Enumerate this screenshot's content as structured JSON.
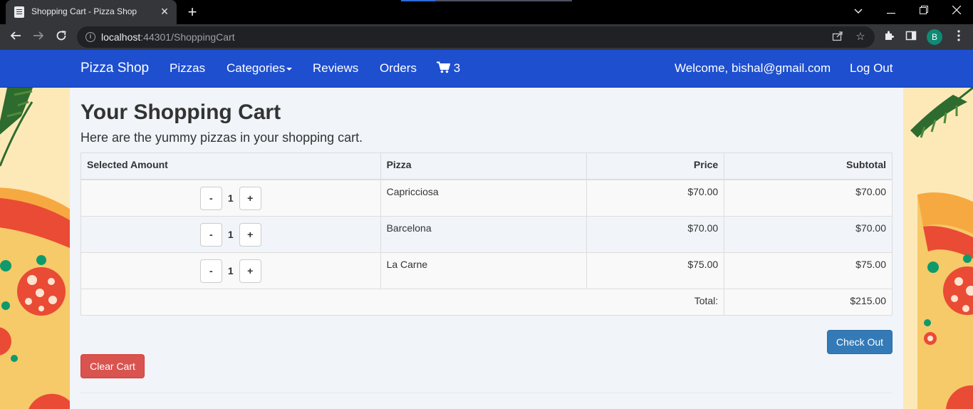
{
  "browser": {
    "tab_title": "Shopping Cart - Pizza Shop",
    "url_host": "localhost",
    "url_rest": ":44301/ShoppingCart",
    "profile_initial": "B"
  },
  "nav": {
    "brand": "Pizza Shop",
    "pizzas": "Pizzas",
    "categories": "Categories",
    "reviews": "Reviews",
    "orders": "Orders",
    "cart_count": "3",
    "welcome": "Welcome, bishal@gmail.com",
    "logout": "Log Out"
  },
  "page": {
    "title": "Your Shopping Cart",
    "subtitle": "Here are the yummy pizzas in your shopping cart."
  },
  "table": {
    "headers": [
      "Selected Amount",
      "Pizza",
      "Price",
      "Subtotal"
    ],
    "rows": [
      {
        "qty": "1",
        "pizza": "Capricciosa",
        "price": "$70.00",
        "subtotal": "$70.00"
      },
      {
        "qty": "1",
        "pizza": "Barcelona",
        "price": "$70.00",
        "subtotal": "$70.00"
      },
      {
        "qty": "1",
        "pizza": "La Carne",
        "price": "$75.00",
        "subtotal": "$75.00"
      }
    ],
    "minus": "-",
    "plus": "+",
    "total_label": "Total:",
    "total_value": "$215.00"
  },
  "actions": {
    "checkout": "Check Out",
    "clear": "Clear Cart"
  },
  "colors": {
    "navbar": "#1d4fcf",
    "checkout": "#337ab7",
    "clear": "#d9534f"
  }
}
